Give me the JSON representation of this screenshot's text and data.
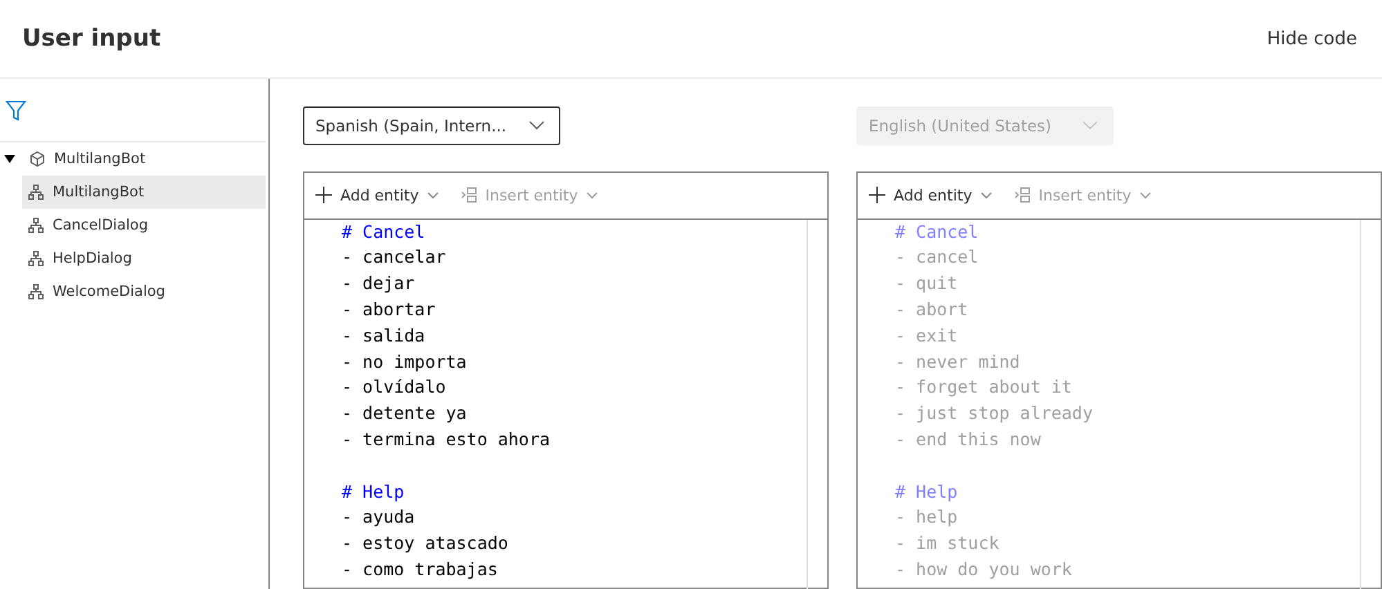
{
  "header": {
    "title": "User input",
    "action": "Hide code"
  },
  "sidebar": {
    "tree": [
      {
        "label": "MultilangBot",
        "kind": "bot",
        "expanded": true,
        "selected": false,
        "children": [
          {
            "label": "MultilangBot",
            "kind": "dialog",
            "selected": true
          },
          {
            "label": "CancelDialog",
            "kind": "dialog",
            "selected": false
          },
          {
            "label": "HelpDialog",
            "kind": "dialog",
            "selected": false
          },
          {
            "label": "WelcomeDialog",
            "kind": "dialog",
            "selected": false
          }
        ]
      }
    ]
  },
  "editors": [
    {
      "language": "Spanish (Spain, Intern...",
      "disabled": false,
      "toolbar": {
        "add": "Add entity",
        "insert": "Insert entity"
      },
      "lines": [
        {
          "kind": "heading",
          "text": "# Cancel"
        },
        {
          "kind": "item",
          "text": "- cancelar"
        },
        {
          "kind": "item",
          "text": "- dejar"
        },
        {
          "kind": "item",
          "text": "- abortar"
        },
        {
          "kind": "item",
          "text": "- salida"
        },
        {
          "kind": "item",
          "text": "- no importa"
        },
        {
          "kind": "item",
          "text": "- olvídalo"
        },
        {
          "kind": "item",
          "text": "- detente ya"
        },
        {
          "kind": "item",
          "text": "- termina esto ahora"
        },
        {
          "kind": "blank"
        },
        {
          "kind": "heading",
          "text": "# Help"
        },
        {
          "kind": "item",
          "text": "- ayuda"
        },
        {
          "kind": "item",
          "text": "- estoy atascado"
        },
        {
          "kind": "item",
          "text": "- como trabajas"
        }
      ]
    },
    {
      "language": "English (United States)",
      "disabled": true,
      "toolbar": {
        "add": "Add entity",
        "insert": "Insert entity"
      },
      "lines": [
        {
          "kind": "heading",
          "text": "# Cancel"
        },
        {
          "kind": "item",
          "text": "- cancel"
        },
        {
          "kind": "item",
          "text": "- quit"
        },
        {
          "kind": "item",
          "text": "- abort"
        },
        {
          "kind": "item",
          "text": "- exit"
        },
        {
          "kind": "item",
          "text": "- never mind"
        },
        {
          "kind": "item",
          "text": "- forget about it"
        },
        {
          "kind": "item",
          "text": "- just stop already"
        },
        {
          "kind": "item",
          "text": "- end this now"
        },
        {
          "kind": "blank"
        },
        {
          "kind": "heading",
          "text": "# Help"
        },
        {
          "kind": "item",
          "text": "- help"
        },
        {
          "kind": "item",
          "text": "- im stuck"
        },
        {
          "kind": "item",
          "text": "- how do you work"
        }
      ]
    }
  ]
}
